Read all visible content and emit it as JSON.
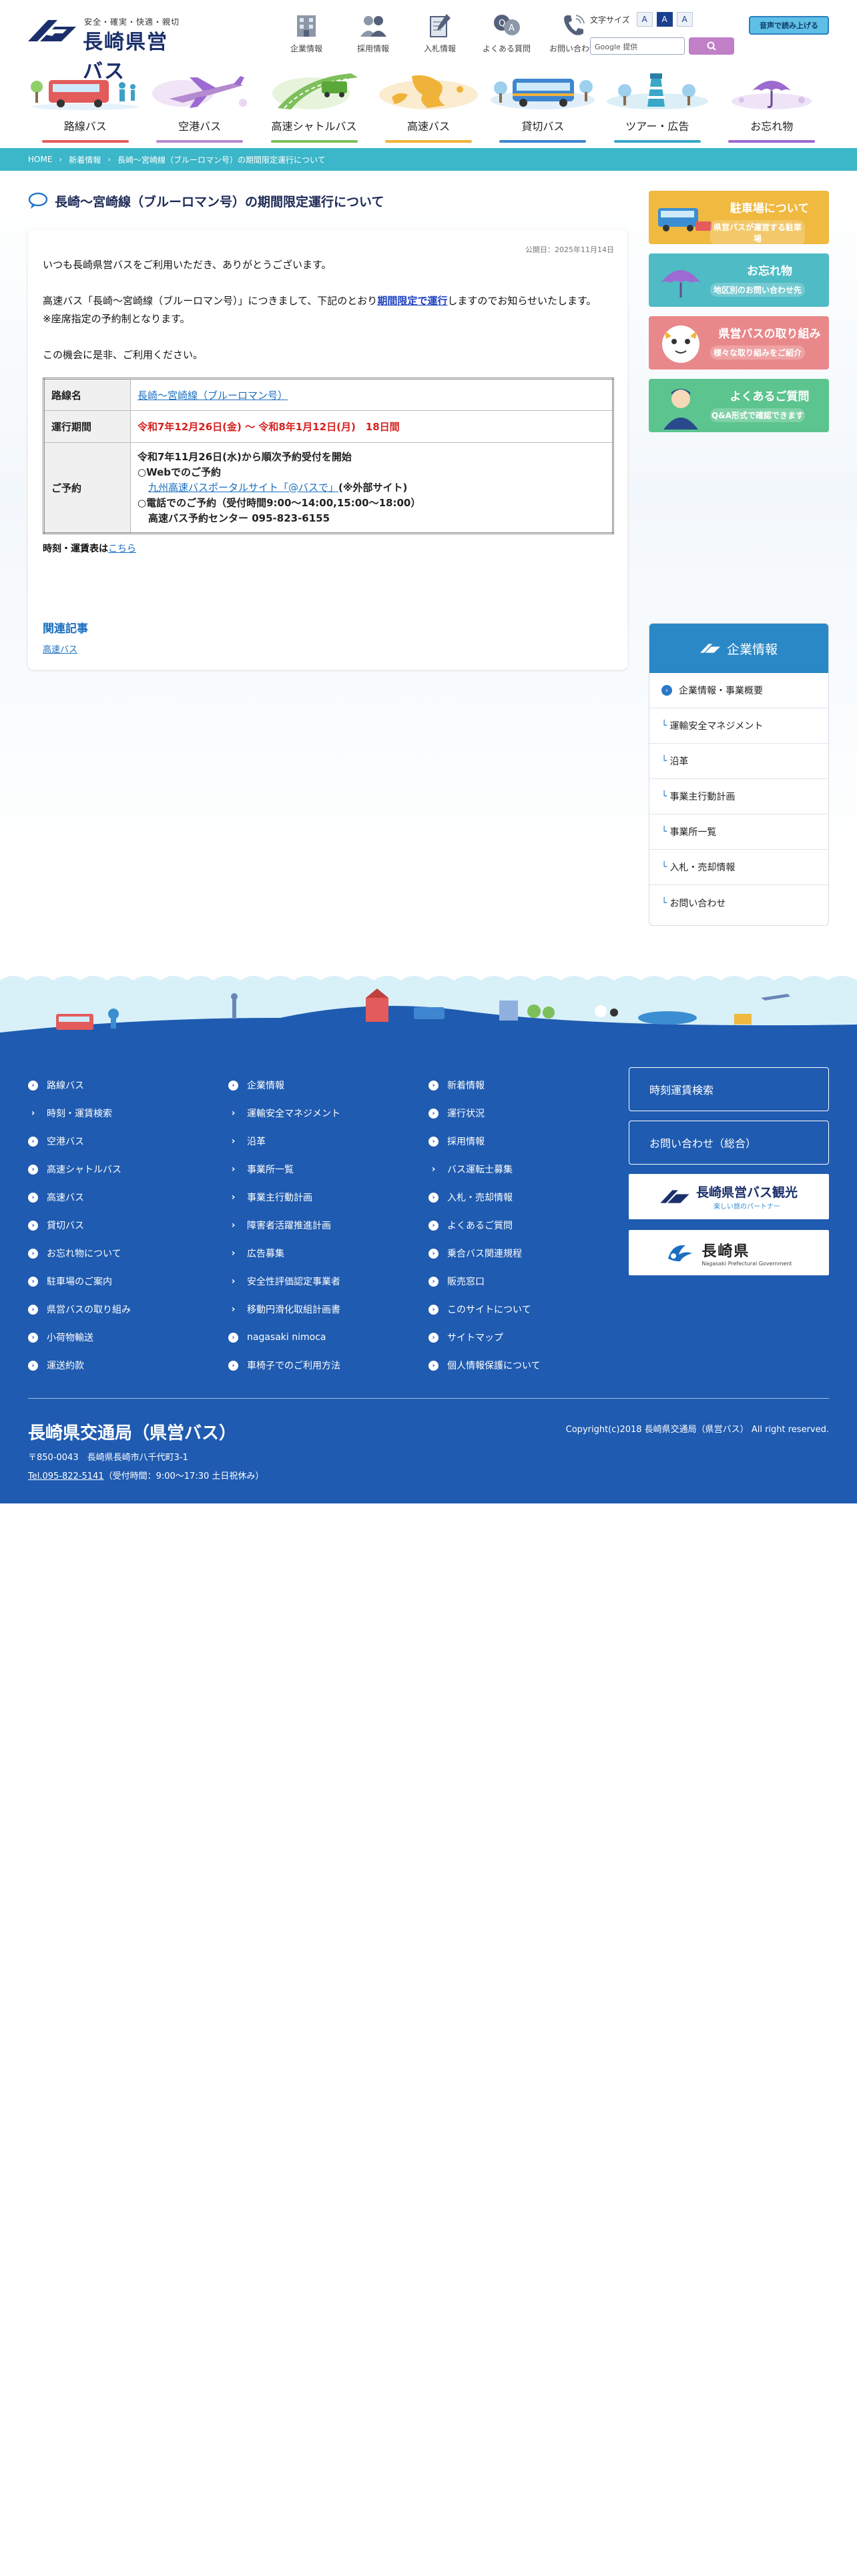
{
  "header": {
    "tagline": "安全・確実・快適・親切",
    "site_name": "長崎県営バス",
    "util": [
      {
        "label": "企業情報",
        "icon": "building-icon"
      },
      {
        "label": "採用情報",
        "icon": "people-icon"
      },
      {
        "label": "入札情報",
        "icon": "document-pen-icon"
      },
      {
        "label": "よくある質問",
        "icon": "qa-icon"
      },
      {
        "label": "お問い合わせ",
        "icon": "phone-icon"
      }
    ],
    "font_size_label": "文字サイズ",
    "font_sizes": [
      "A",
      "A",
      "A"
    ],
    "search_placeholder": "Google 提供",
    "voice_button": "音声で読み上げる"
  },
  "gnav": [
    {
      "label": "路線バス",
      "color": "#e35b5b"
    },
    {
      "label": "空港バス",
      "color": "#b58ad1"
    },
    {
      "label": "高速シャトルバス",
      "color": "#7dbf5a"
    },
    {
      "label": "高速バス",
      "color": "#f0b33a"
    },
    {
      "label": "貸切バス",
      "color": "#3f86d1"
    },
    {
      "label": "ツアー・広告",
      "color": "#3aa7c8"
    },
    {
      "label": "お忘れ物",
      "color": "#9c6ad0"
    }
  ],
  "breadcrumb": [
    "HOME",
    "新着情報",
    "長崎～宮崎線（ブルーロマン号）の期間限定運行について"
  ],
  "article": {
    "title": "長崎～宮崎線（ブルーロマン号）の期間限定運行について",
    "published": "公開日：2025年11月14日",
    "greeting": "いつも長崎県営バスをご利用いただき、ありがとうございます。",
    "p1_before": "高速バス「長崎～宮崎線（ブルーロマン号）」につきまして、下記のとおり",
    "p1_highlight": "期間限定で運行",
    "p1_after": "しますのでお知らせいたします。",
    "p2": "※座席指定の予約制となります。",
    "p3": "この機会に是非、ご利用ください。",
    "table": {
      "route_label": "路線名",
      "route_value": "長崎～宮崎線（ブルーロマン号）",
      "period_label": "運行期間",
      "period_value": "令和7年12月26日(金) ～ 令和8年1月12日(月)　18日間",
      "reserve_label": "ご予約",
      "reserve_line1": "令和7年11月26日(水)から順次予約受付を開始",
      "reserve_line2": "○Webでのご予約",
      "reserve_link": "九州高速バスポータルサイト「@バスで」",
      "reserve_link_note": "(※外部サイト)",
      "reserve_line4": "○電話でのご予約（受付時間9:00～14:00,15:00～18:00）",
      "reserve_line5": "高速バス予約センター 095-823-6155"
    },
    "timetable_text": "時刻・運賃表は",
    "timetable_link": "こちら",
    "related_heading": "関連記事",
    "related_link": "高速バス"
  },
  "sidebar": {
    "banners": [
      {
        "title": "駐車場について",
        "sub": "県営バスが運営する駐車場",
        "color": "#f0b940"
      },
      {
        "title": "お忘れ物",
        "sub": "地区別のお問い合わせ先",
        "color": "#4fbbc4"
      },
      {
        "title": "県営バスの取り組み",
        "sub": "様々な取り組みをご紹介",
        "color": "#e9888a"
      },
      {
        "title": "よくあるご質問",
        "sub": "Q&A形式で確認できます",
        "color": "#5cc48e"
      }
    ],
    "menu_title": "企業情報",
    "menu": [
      "企業情報・事業概要",
      "運輸安全マネジメント",
      "沿革",
      "事業主行動計画",
      "事業所一覧",
      "入札・売却情報",
      "お問い合わせ"
    ]
  },
  "footer": {
    "col1": [
      "路線バス",
      "時刻・運賃検索",
      "空港バス",
      "高速シャトルバス",
      "高速バス",
      "貸切バス",
      "お忘れ物について",
      "駐車場のご案内",
      "県営バスの取り組み",
      "小荷物輸送",
      "運送約款"
    ],
    "col2": [
      "企業情報",
      "運輸安全マネジメント",
      "沿革",
      "事業所一覧",
      "事業主行動計画",
      "障害者活躍推進計画",
      "広告募集",
      "安全性評価認定事業者",
      "移動円滑化取組計画書",
      "nagasaki nimoca",
      "車椅子でのご利用方法"
    ],
    "col3": [
      "新着情報",
      "運行状況",
      "採用情報",
      "バス運転士募集",
      "入札・売却情報",
      "よくあるご質問",
      "乗合バス関連規程",
      "販売窓口",
      "このサイトについて",
      "サイトマップ",
      "個人情報保護について"
    ],
    "btn1": "時刻運賃検索",
    "btn2": "お問い合わせ（総合）",
    "badge1_title": "長崎県営バス観光",
    "badge1_sub": "楽しい旅のパートナー",
    "badge2_title": "長崎県",
    "badge2_sub": "Nagasaki Prefectural Government",
    "org_name": "長崎県交通局（県営バス）",
    "address": "〒850-0043　長崎県長崎市八千代町3-1",
    "tel_link": "Tel.095-822-5141",
    "tel_note": "（受付時間：9:00～17:30 土日祝休み）",
    "copyright": "Copyright(c)2018 長崎県交通局（県営バス） All right reserved."
  }
}
